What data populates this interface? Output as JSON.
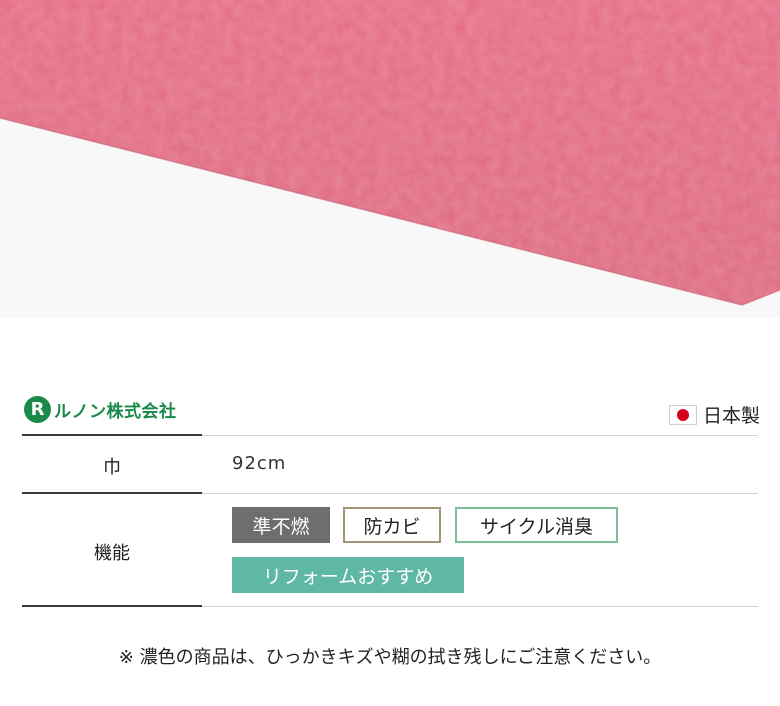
{
  "brand": {
    "mark": "R",
    "name": "ルノン株式会社"
  },
  "origin": {
    "flag_icon": "japan-flag-icon",
    "label": "日本製"
  },
  "specs": {
    "width": {
      "label": "巾",
      "value": "92cm"
    },
    "features": {
      "label": "機能",
      "tags": [
        {
          "text": "準不燃",
          "style": "solid",
          "color": "#6e6e6e"
        },
        {
          "text": "防カビ",
          "style": "outline",
          "color": "#a09479"
        },
        {
          "text": "サイクル消臭",
          "style": "outline",
          "color": "#7dbf9a"
        },
        {
          "text": "リフォームおすすめ",
          "style": "solid",
          "color": "#5fb8a5"
        }
      ]
    }
  },
  "note": "※ 濃色の商品は、ひっかきキズや糊の拭き残しにご注意ください。",
  "colors": {
    "product": "#e46d86",
    "brand_green": "#1a8a4a"
  }
}
